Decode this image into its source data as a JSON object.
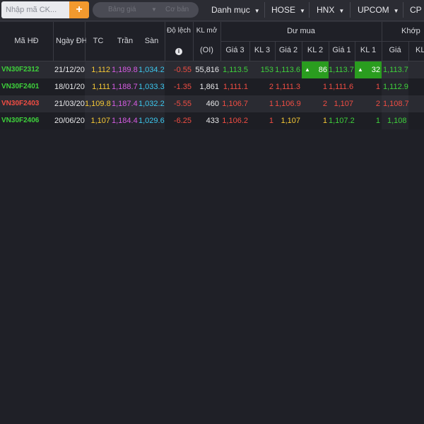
{
  "toolbar": {
    "search_placeholder": "Nhập mã CK...",
    "add_label": "+",
    "segment": {
      "left": "Bảng giá",
      "right": "Cơ bản"
    },
    "tabs": [
      {
        "label": "Danh mục"
      },
      {
        "label": "HOSE"
      },
      {
        "label": "HNX"
      },
      {
        "label": "UPCOM"
      },
      {
        "label": "CP n"
      }
    ]
  },
  "header": {
    "ma_hd": "Mã HĐ",
    "ngay_dh": "Ngày ĐH",
    "tc": "TC",
    "tran": "Trần",
    "san": "Sàn",
    "do_lech": "Độ lệch",
    "do_lech_icon": "i",
    "kl_mo": "KL mở",
    "oi": "(OI)",
    "du_mua": "Dư mua",
    "khop": "Khớp",
    "sub": [
      "Giá 3",
      "KL 3",
      "Giá 2",
      "KL 2",
      "Giá 1",
      "KL 1",
      "Giá",
      "KL"
    ]
  },
  "rows": [
    {
      "symbol": "VN30F2312",
      "date": "21/12/20",
      "tc": "1,112",
      "tran": "1,189.8",
      "san": "1,034.2",
      "lech": "-0.55",
      "oi": "55,816",
      "g3": "1,113.5",
      "k3": "153",
      "g2": "1,113.6",
      "k2": "86",
      "g1": "1,113.7",
      "k1": "32",
      "kp": "1,113.7"
    },
    {
      "symbol": "VN30F2401",
      "date": "18/01/20",
      "tc": "1,111",
      "tran": "1,188.7",
      "san": "1,033.3",
      "lech": "-1.35",
      "oi": "1,861",
      "g3": "1,111.1",
      "k3": "2",
      "g2": "1,111.3",
      "k2": "1",
      "g1": "1,111.6",
      "k1": "1",
      "kp": "1,112.9"
    },
    {
      "symbol": "VN30F2403",
      "date": "21/03/20",
      "tc": "1,109.8",
      "tran": "1,187.4",
      "san": "1,032.2",
      "lech": "-5.55",
      "oi": "460",
      "g3": "1,106.7",
      "k3": "1",
      "g2": "1,106.9",
      "k2": "2",
      "g1": "1,107",
      "k1": "2",
      "kp": "1,108.7"
    },
    {
      "symbol": "VN30F2406",
      "date": "20/06/20",
      "tc": "1,107",
      "tran": "1,184.4",
      "san": "1,029.6",
      "lech": "-6.25",
      "oi": "433",
      "g3": "1,106.2",
      "k3": "1",
      "g2": "1,107",
      "k2": "1",
      "g1": "1,107.2",
      "k1": "1",
      "kp": "1,108"
    }
  ],
  "colors": {
    "background": "#1f2027",
    "up": "#3ed13b",
    "down": "#f14d43",
    "reference": "#f6c935",
    "ceiling": "#d65ce3",
    "floor": "#3cc7ee",
    "accent": "#f2992e",
    "highlight": "#2a9d1f"
  }
}
